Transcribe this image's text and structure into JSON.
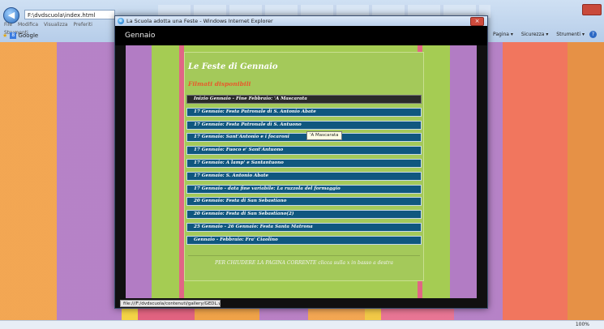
{
  "browser": {
    "address": "F:\\dvdscuola\\index.html",
    "menu": [
      "File",
      "Modifica",
      "Visualizza",
      "Preferiti",
      "Strumenti"
    ],
    "favorites_item": "Google",
    "cmdbar": [
      "Pagina",
      "Sicurezza",
      "Strumenti"
    ],
    "zoom": "100%"
  },
  "popup": {
    "window_title": "La Scuola adotta una Feste - Windows Internet Explorer",
    "header_title": "Gennaio",
    "panel_title": "Le Feste di Gennaio",
    "panel_subtitle": "Filmati disponibili",
    "films": [
      "Inizio Gennaio - Fine Febbraio: 'A Mascarata",
      "17 Gennaio: Festa Patronale di S. Antonio Abate",
      "17 Gennaio: Festa Patronale di S. Antuono",
      "17 Gennaio: Sant'Antonio e i focaroni",
      "17 Gennaio: Fuoco e' Sant'Antuono",
      "17 Gennaio: A lamp' e Santantuono",
      "17 Gennaio: S. Antonio Abate",
      "17 Gennaio - data fine variabile: La ruzzola del formaggio",
      "20 Gennaio: Festa di San Sebastiano",
      "20 Gennaio: Festa di San Sebastiano(2)",
      "25 Gennaio - 26 Gennaio: Festa Santa Matrona",
      "Gennaio - Febbraio: Fra' Ciaolino"
    ],
    "active_index": 0,
    "tooltip": "'A Mascarata",
    "footer": "PER CHIUDERE LA PAGINA CORRENTE clicca sulla x in basso a destra",
    "status_url": "file:///F:/dvdscuola/contenuti/gallery/GEDL.wmv"
  }
}
